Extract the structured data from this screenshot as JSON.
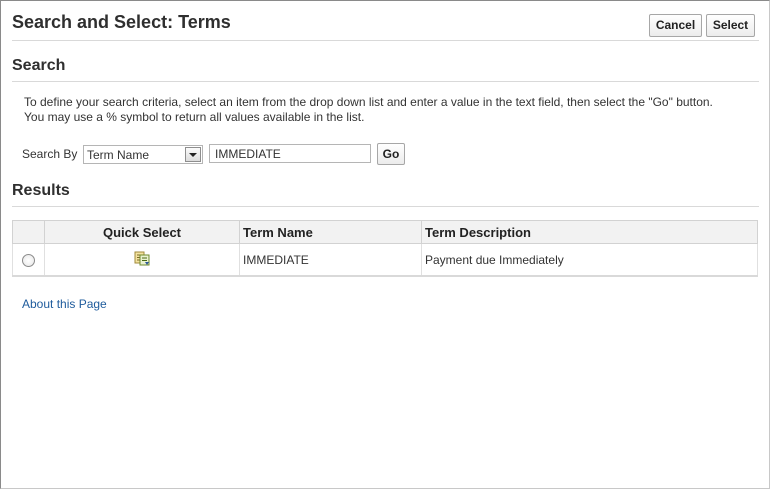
{
  "header": {
    "title": "Search and Select: Terms",
    "cancel_label": "Cancel",
    "select_label": "Select"
  },
  "search": {
    "heading": "Search",
    "instructions_line1": "To define your search criteria, select an item from the drop down list and enter a value in the text field, then select the \"Go\" button.",
    "instructions_line2": "You may use a % symbol to return all values available in the list.",
    "search_by_label": "Search By",
    "search_by_selected": "Term Name",
    "search_value": "IMMEDIATE",
    "go_label": "Go"
  },
  "results": {
    "heading": "Results",
    "columns": [
      "",
      "Quick Select",
      "Term Name",
      "Term Description"
    ],
    "rows": [
      {
        "selected": false,
        "quick_select_icon": "quick-select-icon",
        "term_name": "IMMEDIATE",
        "term_description": "Payment due Immediately"
      }
    ]
  },
  "footer": {
    "about_link": "About this Page"
  },
  "colors": {
    "link": "#1e5b9c",
    "header_bg": "#f2f2f2",
    "rule": "#d9d9d9"
  }
}
